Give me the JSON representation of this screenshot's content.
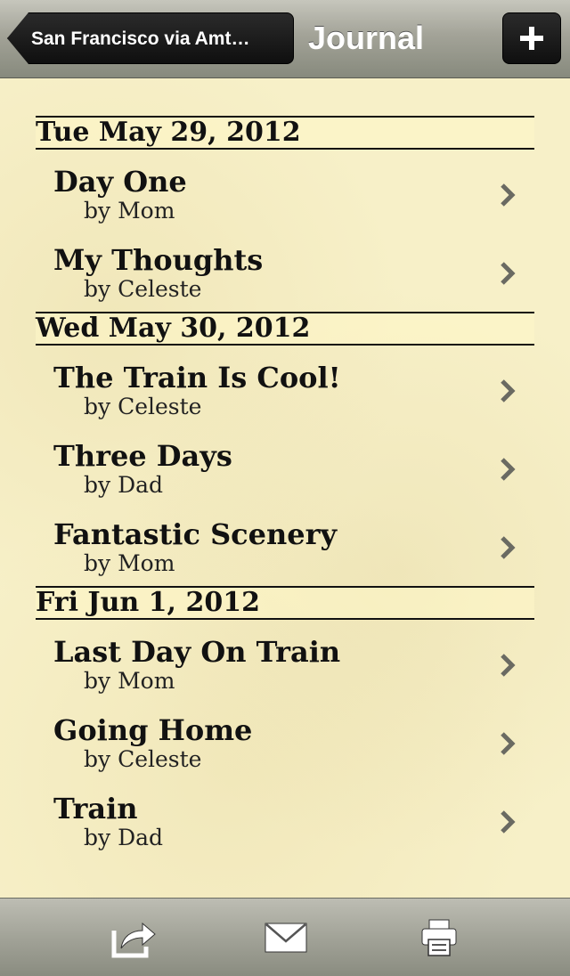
{
  "navbar": {
    "back_label": "San Francisco via Amt…",
    "title": "Journal"
  },
  "sections": [
    {
      "date": "Tue May 29, 2012",
      "entries": [
        {
          "title": "Day One",
          "author": "by Mom"
        },
        {
          "title": "My Thoughts",
          "author": "by Celeste"
        }
      ]
    },
    {
      "date": "Wed May 30, 2012",
      "entries": [
        {
          "title": "The Train Is Cool!",
          "author": "by Celeste"
        },
        {
          "title": "Three Days",
          "author": "by Dad"
        },
        {
          "title": "Fantastic Scenery",
          "author": "by Mom"
        }
      ]
    },
    {
      "date": "Fri Jun 1, 2012",
      "entries": [
        {
          "title": "Last Day On Train",
          "author": "by Mom"
        },
        {
          "title": "Going Home",
          "author": "by Celeste"
        },
        {
          "title": "Train",
          "author": "by Dad"
        }
      ]
    }
  ],
  "toolbar": {
    "icons": [
      "share-icon",
      "mail-icon",
      "print-icon"
    ]
  }
}
